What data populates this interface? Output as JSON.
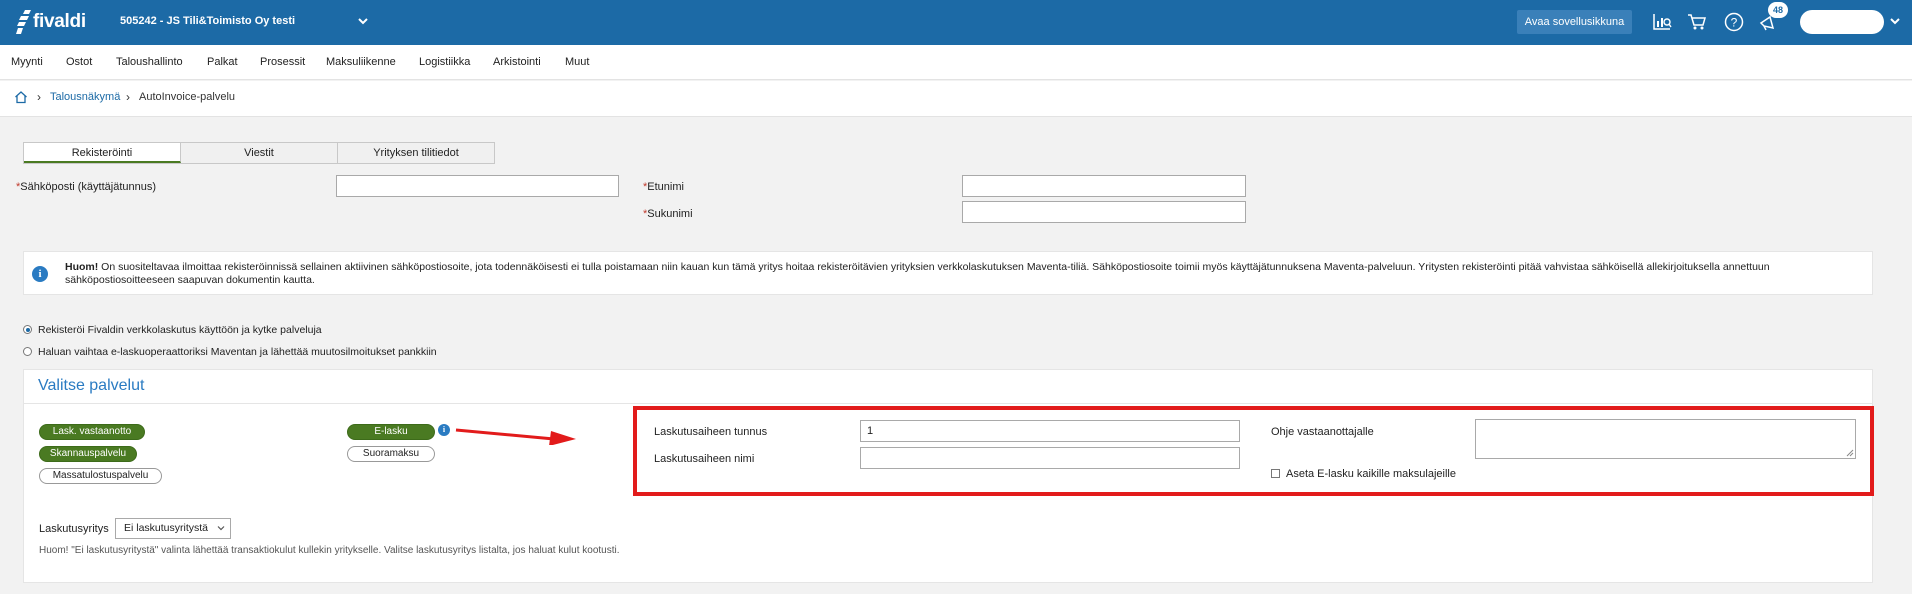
{
  "topbar": {
    "logo_text": "fivaldi",
    "company": "505242 - JS Tili&Toimisto Oy testi",
    "open_app_button": "Avaa sovellusikkuna",
    "notification_count": "48",
    "icons": [
      "chart-search-icon",
      "cart-icon",
      "help-icon",
      "megaphone-icon",
      "chevron-down-icon"
    ]
  },
  "menu": [
    "Myynti",
    "Ostot",
    "Taloushallinto",
    "Palkat",
    "Prosessit",
    "Maksuliikenne",
    "Logistiikka",
    "Arkistointi",
    "Muut"
  ],
  "breadcrumb": {
    "link": "Talousnäkymä",
    "current": "AutoInvoice-palvelu"
  },
  "tabs": [
    "Rekisteröinti",
    "Viestit",
    "Yrityksen tilitiedot"
  ],
  "form": {
    "required_mark": "*",
    "email_label": "Sähköposti (käyttäjätunnus)",
    "email_value": "",
    "firstname_label": "Etunimi",
    "firstname_value": "",
    "lastname_label": "Sukunimi",
    "lastname_value": ""
  },
  "info": {
    "icon": "i",
    "bold": "Huom!",
    "text": " On suositeltavaa ilmoittaa rekisteröinnissä sellainen aktiivinen sähköpostiosoite, jota todennäköisesti ei tulla poistamaan niin kauan kun tämä yritys hoitaa rekisteröitävien yrityksien verkkolaskutuksen Maventa-tiliä. Sähköpostiosoite toimii myös käyttäjätunnuksena Maventa-palveluun. Yritysten rekisteröinti pitää vahvistaa sähköisellä allekirjoituksella annettuun sähköpostiosoitteeseen saapuvan dokumentin kautta."
  },
  "radios": [
    {
      "label": "Rekisteröi Fivaldin verkkolaskutus käyttöön ja kytke palveluja",
      "checked": true
    },
    {
      "label": "Haluan vaihtaa e-laskuoperaattoriksi Maventan ja lähettää muutosilmoitukset pankkiin",
      "checked": false
    }
  ],
  "services": {
    "title": "Valitse palvelut",
    "left_pills": [
      {
        "label": "Lask. vastaanotto",
        "active": true
      },
      {
        "label": "Skannauspalvelu",
        "active": true
      },
      {
        "label": "Massatulostuspalvelu",
        "active": false
      }
    ],
    "mid_pills": [
      {
        "label": "E-lasku",
        "active": true
      },
      {
        "label": "Suoramaksu",
        "active": false
      }
    ],
    "help_icon": "i",
    "billing_id_label": "Laskutusaiheen tunnus",
    "billing_id_value": "1",
    "billing_name_label": "Laskutusaiheen nimi",
    "billing_name_value": "",
    "recipient_guide_label": "Ohje vastaanottajalle",
    "set_all_label": "Aseta E-lasku kaikille maksulajeille",
    "billing_company_label": "Laskutusyritys",
    "billing_company_value": "Ei laskutusyritystä",
    "note": "Huom! \"Ei laskutusyritystä\" valinta lähettää transaktiokulut kullekin yritykselle. Valitse laskutusyritys listalta, jos haluat kulut kootusti."
  },
  "colors": {
    "topbar": "#1c6aa6",
    "accent_green": "#4a7a22",
    "highlight_red": "#e21b1b",
    "link_blue": "#1c6aa6"
  }
}
